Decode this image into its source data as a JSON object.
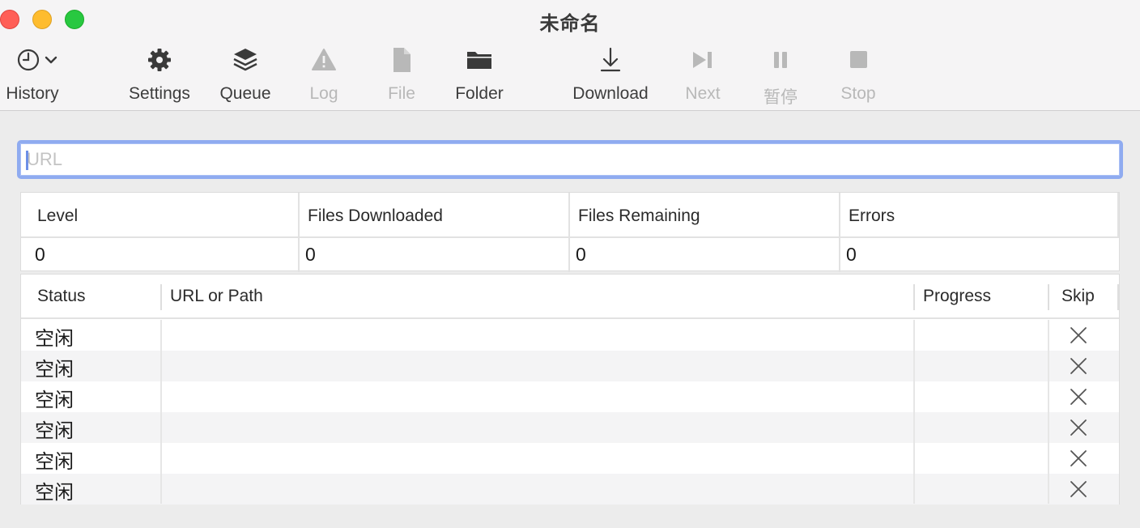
{
  "window": {
    "title": "未命名"
  },
  "toolbar": {
    "history": "History",
    "settings": "Settings",
    "queue": "Queue",
    "log": "Log",
    "file": "File",
    "folder": "Folder",
    "download": "Download",
    "next": "Next",
    "pause": "暂停",
    "stop": "Stop"
  },
  "url_input": {
    "placeholder": "URL",
    "value": ""
  },
  "stats": {
    "headers": {
      "level": "Level",
      "files_downloaded": "Files Downloaded",
      "files_remaining": "Files Remaining",
      "errors": "Errors"
    },
    "values": {
      "level": "0",
      "files_downloaded": "0",
      "files_remaining": "0",
      "errors": "0"
    }
  },
  "queue_table": {
    "headers": {
      "status": "Status",
      "url_or_path": "URL or Path",
      "progress": "Progress",
      "skip": "Skip"
    },
    "rows": [
      {
        "status": "空闲",
        "url_or_path": "",
        "progress": ""
      },
      {
        "status": "空闲",
        "url_or_path": "",
        "progress": ""
      },
      {
        "status": "空闲",
        "url_or_path": "",
        "progress": ""
      },
      {
        "status": "空闲",
        "url_or_path": "",
        "progress": ""
      },
      {
        "status": "空闲",
        "url_or_path": "",
        "progress": ""
      },
      {
        "status": "空闲",
        "url_or_path": "",
        "progress": ""
      }
    ]
  },
  "colors": {
    "close": "#ff5f57",
    "minimize": "#febc2e",
    "maximize": "#28c840",
    "focus_ring": "#8fabf0",
    "disabled_text": "#b8b8b8"
  }
}
